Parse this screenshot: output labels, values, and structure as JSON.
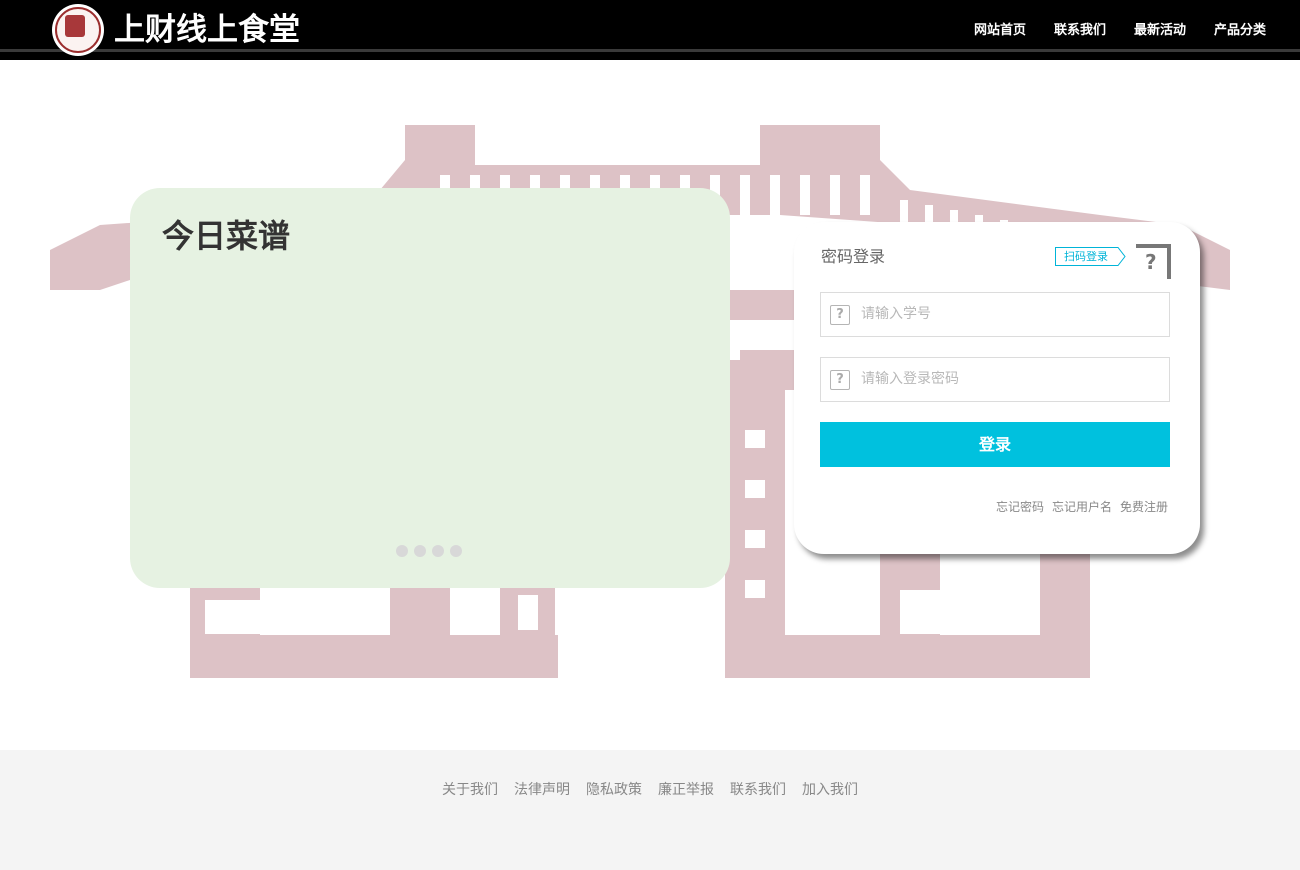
{
  "header": {
    "site_title": "上财线上食堂",
    "nav": [
      "网站首页",
      "联系我们",
      "最新活动",
      "产品分类"
    ]
  },
  "menu_card": {
    "title": "今日菜谱",
    "slide_count": 4
  },
  "login": {
    "title": "密码登录",
    "qr_tag": "扫码登录",
    "username_placeholder": "请输入学号",
    "password_placeholder": "请输入登录密码",
    "submit_label": "登录",
    "links": [
      "忘记密码",
      "忘记用户名",
      "免费注册"
    ]
  },
  "footer": {
    "links": [
      "关于我们",
      "法律声明",
      "隐私政策",
      "廉正举报",
      "联系我们",
      "加入我们"
    ]
  },
  "colors": {
    "header_bg": "#000000",
    "accent": "#00c1de",
    "menu_card_bg": "#e6f2e2",
    "building_tint": "#ddc2c6",
    "footer_bg": "#f4f4f4"
  }
}
